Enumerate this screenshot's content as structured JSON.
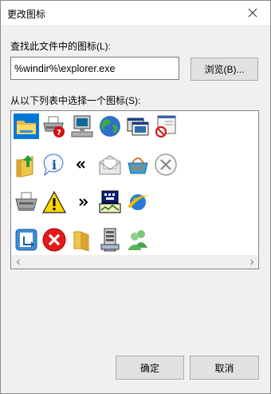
{
  "dialog": {
    "title": "更改图标",
    "path_label": "查找此文件中的图标(L):",
    "path_value": "%windir%\\explorer.exe",
    "browse_label": "浏览(B)...",
    "list_label": "从以下列表中选择一个图标(S):",
    "ok_label": "确定",
    "cancel_label": "取消"
  },
  "icons": [
    [
      "folder-icon",
      "print-help-icon",
      "computer-icon",
      "globe-icon",
      "windows-icon",
      "stop-window-icon"
    ],
    [
      "folder-up-icon",
      "info-icon",
      "double-left-arrow-icon",
      "mail-icon",
      "shopping-basket-icon",
      "circle-x-icon"
    ],
    [
      "printer-icon",
      "warning-icon",
      "double-right-arrow-icon",
      "network-monitor-icon",
      "internet-explorer-icon"
    ],
    [
      "window-arrow-icon",
      "error-icon",
      "folders-icon",
      "server-icon",
      "users-icon"
    ]
  ],
  "selected_icon": "folder-icon",
  "colors": {
    "selection": "#0078d7",
    "button_face": "#e1e1e1"
  }
}
